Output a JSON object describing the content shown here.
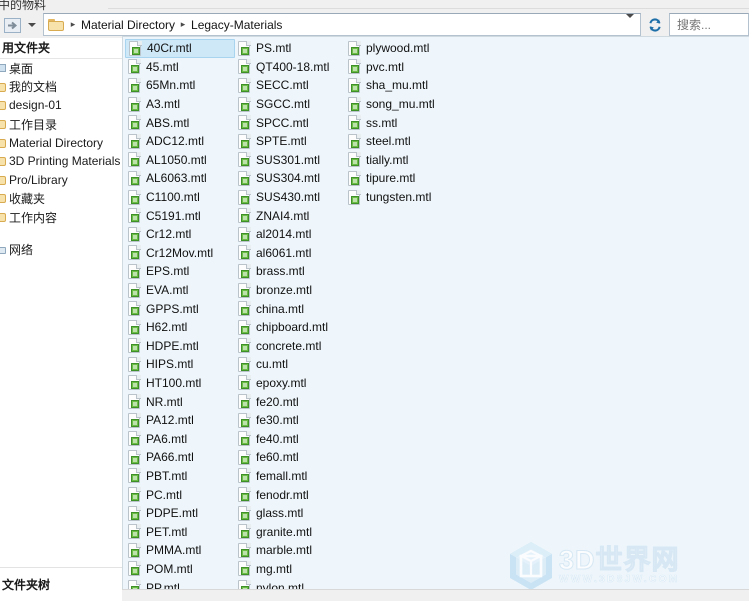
{
  "window": {
    "cut_title": "中的物料",
    "bottom_left_label": "文件夹树"
  },
  "toolbar": {
    "forward_icon": "forward-arrow-icon",
    "history_dropdown_icon": "chevron-down-icon",
    "folder_icon": "folder-icon",
    "breadcrumb": [
      "Material Directory",
      "Legacy-Materials"
    ],
    "breadcrumb_separator": "▸",
    "address_dropdown_icon": "chevron-down-icon",
    "refresh_icon": "refresh-icon",
    "refresh_color": "#1e6fa8"
  },
  "search": {
    "placeholder": "搜索...",
    "value": "",
    "icon": "search-icon"
  },
  "sidebar": {
    "header": "用文件夹",
    "items": [
      {
        "label": "桌面",
        "icon": "desktop-icon"
      },
      {
        "label": "我的文档",
        "icon": "folder-icon"
      },
      {
        "label": "design-01",
        "icon": "folder-icon"
      },
      {
        "label": "工作目录",
        "icon": "folder-icon"
      },
      {
        "label": "Material Directory",
        "icon": "folder-icon"
      },
      {
        "label": "3D Printing Materials",
        "icon": "folder-icon"
      },
      {
        "label": "Pro/Library",
        "icon": "folder-icon"
      },
      {
        "label": "收藏夹",
        "icon": "folder-icon"
      },
      {
        "label": "工作内容",
        "icon": "folder-icon"
      }
    ],
    "network": {
      "label": "网络",
      "icon": "network-icon"
    }
  },
  "file_list": {
    "selected": "40Cr.mtl",
    "file_icon": "mtl-file-icon",
    "columns": [
      {
        "items": [
          "40Cr.mtl",
          "45.mtl",
          "65Mn.mtl",
          "A3.mtl",
          "ABS.mtl",
          "ADC12.mtl",
          "AL1050.mtl",
          "AL6063.mtl",
          "C1100.mtl",
          "C5191.mtl",
          "Cr12.mtl",
          "Cr12Mov.mtl",
          "EPS.mtl",
          "EVA.mtl",
          "GPPS.mtl",
          "H62.mtl",
          "HDPE.mtl",
          "HIPS.mtl",
          "HT100.mtl",
          "NR.mtl",
          "PA12.mtl",
          "PA6.mtl",
          "PA66.mtl",
          "PBT.mtl",
          "PC.mtl",
          "PDPE.mtl",
          "PET.mtl",
          "PMMA.mtl",
          "POM.mtl",
          "PP.mtl"
        ]
      },
      {
        "items": [
          "PS.mtl",
          "QT400-18.mtl",
          "SECC.mtl",
          "SGCC.mtl",
          "SPCC.mtl",
          "SPTE.mtl",
          "SUS301.mtl",
          "SUS304.mtl",
          "SUS430.mtl",
          "ZNAI4.mtl",
          "al2014.mtl",
          "al6061.mtl",
          "brass.mtl",
          "bronze.mtl",
          "china.mtl",
          "chipboard.mtl",
          "concrete.mtl",
          "cu.mtl",
          "epoxy.mtl",
          "fe20.mtl",
          "fe30.mtl",
          "fe40.mtl",
          "fe60.mtl",
          "femall.mtl",
          "fenodr.mtl",
          "glass.mtl",
          "granite.mtl",
          "marble.mtl",
          "mg.mtl",
          "nylon.mtl"
        ]
      },
      {
        "items": [
          "plywood.mtl",
          "pvc.mtl",
          "sha_mu.mtl",
          "song_mu.mtl",
          "ss.mtl",
          "steel.mtl",
          "tially.mtl",
          "tipure.mtl",
          "tungsten.mtl"
        ]
      }
    ]
  },
  "watermark": {
    "title": "3D世界网",
    "url": "WWW.3D8JW.COM",
    "logo_icon": "hexagon-cube-icon"
  },
  "colors": {
    "list_background": "#eef6fb",
    "selection": "#cfe8f7",
    "chrome": "#f0f0f0"
  }
}
